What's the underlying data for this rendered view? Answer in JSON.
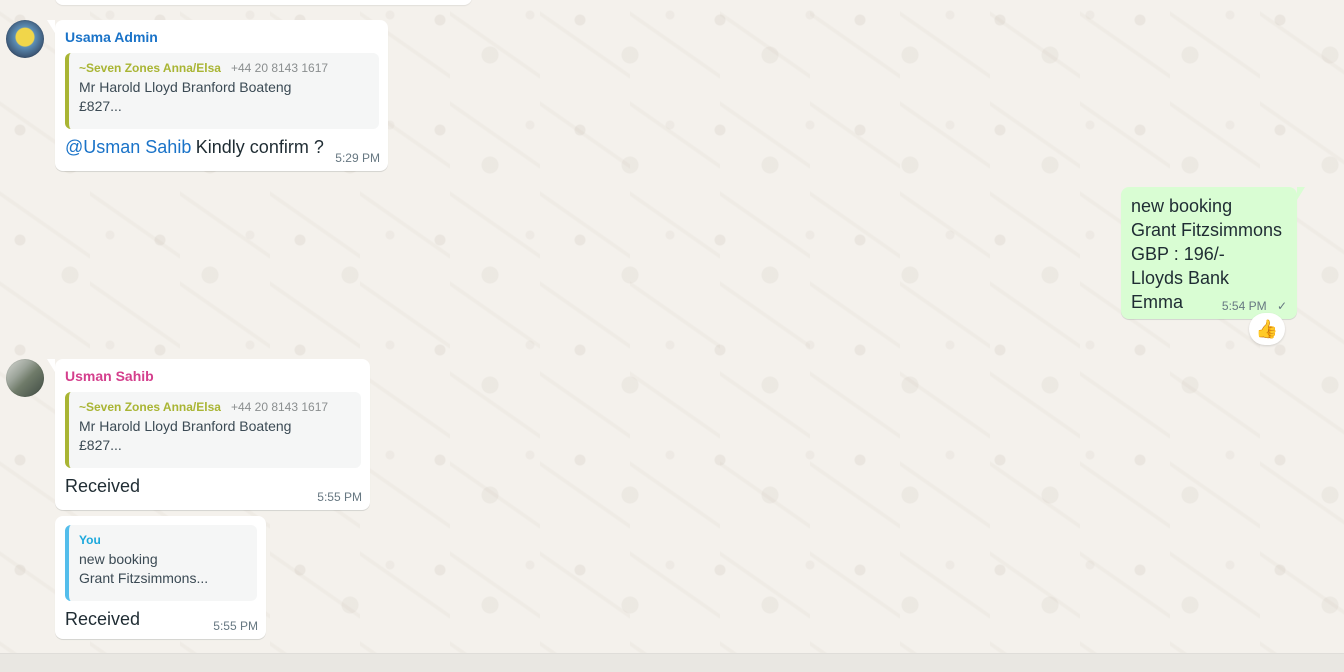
{
  "messages": {
    "admin_message": {
      "sender": "Usama Admin",
      "quote": {
        "sender": "~Seven Zones Anna/Elsa",
        "phone": "+44 20 8143 1617",
        "text": "Mr Harold Lloyd Branford Boateng\n£827..."
      },
      "mention": "@Usman Sahib",
      "text": "Kindly confirm ?",
      "time": "5:29 PM"
    },
    "outgoing_message": {
      "text": "new booking\nGrant Fitzsimmons\nGBP : 196/-\nLloyds  Bank\nEmma",
      "time": "5:54 PM",
      "status": "✓",
      "reaction": "👍"
    },
    "usman_message_1": {
      "sender": "Usman Sahib",
      "quote": {
        "sender": "~Seven Zones Anna/Elsa",
        "phone": "+44 20 8143 1617",
        "text": "Mr Harold Lloyd Branford Boateng\n£827..."
      },
      "text": "Received",
      "time": "5:55 PM"
    },
    "usman_message_2": {
      "quote": {
        "sender": "You",
        "text": "new booking\nGrant Fitzsimmons..."
      },
      "text": "Received",
      "time": "5:55 PM"
    }
  },
  "colors": {
    "admin_name": "#1a73c8",
    "usman_name": "#d43f8d",
    "quote_name": "#a9b534",
    "you_quote": "#1ca8dc",
    "outgoing_bg": "#d9fdd3"
  },
  "icons": {
    "avatar_admin": "avatar",
    "avatar_usman": "avatar",
    "reaction": "thumbs-up-icon",
    "status": "checkmark-icon"
  }
}
